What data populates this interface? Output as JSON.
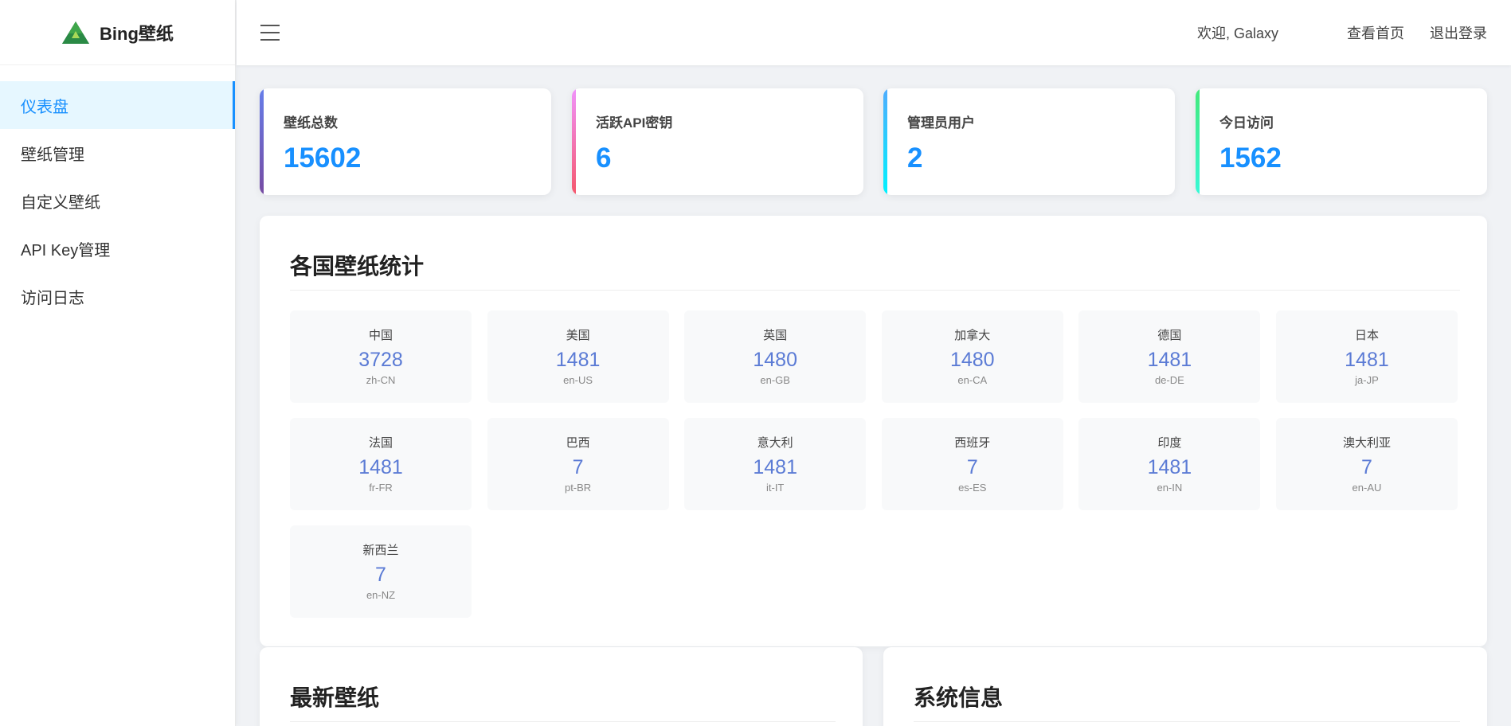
{
  "brand": {
    "name": "Bing壁纸"
  },
  "nav": {
    "items": [
      {
        "label": "仪表盘",
        "active": true
      },
      {
        "label": "壁纸管理"
      },
      {
        "label": "自定义壁纸"
      },
      {
        "label": "API Key管理"
      },
      {
        "label": "访问日志"
      }
    ]
  },
  "header": {
    "menu_icon": "hamburger-icon",
    "welcome": "欢迎, Galaxy",
    "view_home": "查看首页",
    "logout": "退出登录"
  },
  "stats": [
    {
      "label": "壁纸总数",
      "value": "15602",
      "accent": "#667eea"
    },
    {
      "label": "活跃API密钥",
      "value": "6",
      "accent": "#f093fb"
    },
    {
      "label": "管理员用户",
      "value": "2",
      "accent": "#4facfe"
    },
    {
      "label": "今日访问",
      "value": "1562",
      "accent": "#43e97b"
    }
  ],
  "country_stats": {
    "title": "各国壁纸统计",
    "items": [
      {
        "name": "中国",
        "count": "3728",
        "code": "zh-CN"
      },
      {
        "name": "美国",
        "count": "1481",
        "code": "en-US"
      },
      {
        "name": "英国",
        "count": "1480",
        "code": "en-GB"
      },
      {
        "name": "加拿大",
        "count": "1480",
        "code": "en-CA"
      },
      {
        "name": "德国",
        "count": "1481",
        "code": "de-DE"
      },
      {
        "name": "日本",
        "count": "1481",
        "code": "ja-JP"
      },
      {
        "name": "法国",
        "count": "1481",
        "code": "fr-FR"
      },
      {
        "name": "巴西",
        "count": "7",
        "code": "pt-BR"
      },
      {
        "name": "意大利",
        "count": "1481",
        "code": "it-IT"
      },
      {
        "name": "西班牙",
        "count": "7",
        "code": "es-ES"
      },
      {
        "name": "印度",
        "count": "1481",
        "code": "en-IN"
      },
      {
        "name": "澳大利亚",
        "count": "7",
        "code": "en-AU"
      },
      {
        "name": "新西兰",
        "count": "7",
        "code": "en-NZ"
      }
    ]
  },
  "latest": {
    "title": "最新壁纸"
  },
  "system": {
    "title": "系统信息"
  }
}
